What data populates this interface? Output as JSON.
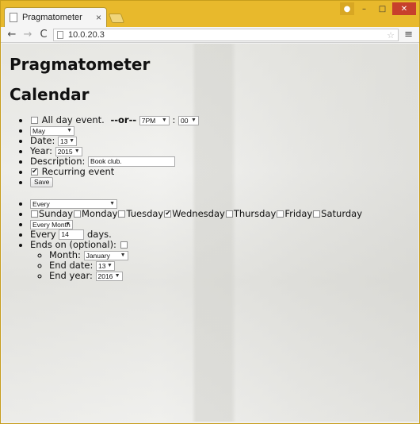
{
  "browser": {
    "tab_title": "Pragmatometer",
    "tab_close": "×",
    "url": "10.0.20.3",
    "back": "←",
    "forward": "→",
    "reload": "C",
    "menu": "≡",
    "star": "☆"
  },
  "page": {
    "app_title": "Pragmatometer",
    "section_title": "Calendar"
  },
  "event": {
    "all_day_label": "All day event.",
    "or_label": "--or--",
    "time_hour": "7PM",
    "time_sep": ":",
    "time_minute": "00",
    "month_select": "May",
    "date_label": "Date:",
    "date_select": "13",
    "year_label": "Year:",
    "year_select": "2015",
    "description_label": "Description:",
    "description_value": "Book club.",
    "recurring_label": "Recurring event",
    "recurring_checked": true,
    "all_day_checked": false,
    "save_label": "Save"
  },
  "recurrence": {
    "frequency_select": "Every",
    "days": [
      {
        "label": "Sunday",
        "checked": false
      },
      {
        "label": "Monday",
        "checked": false
      },
      {
        "label": "Tuesday",
        "checked": false
      },
      {
        "label": "Wednesday",
        "checked": true
      },
      {
        "label": "Thursday",
        "checked": false
      },
      {
        "label": "Friday",
        "checked": false
      },
      {
        "label": "Saturday",
        "checked": false
      }
    ],
    "period_select": "Every Month",
    "every_label": "Every",
    "every_value": "14",
    "days_label": "days.",
    "ends_on_label": "Ends on (optional):",
    "ends_on_checked": false,
    "end_month_label": "Month:",
    "end_month_select": "January",
    "end_date_label": "End date:",
    "end_date_select": "13",
    "end_year_label": "End year:",
    "end_year_select": "2016"
  }
}
